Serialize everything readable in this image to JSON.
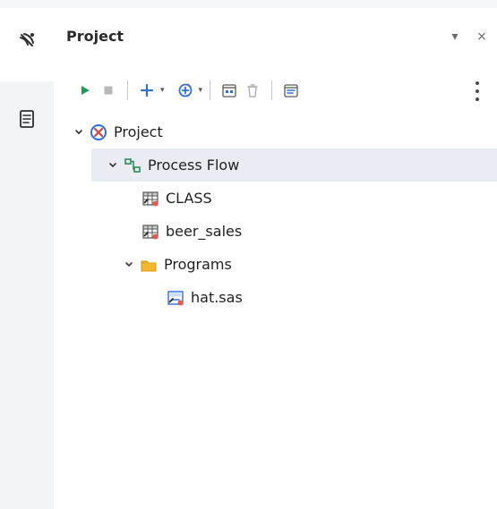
{
  "panel": {
    "title": "Project",
    "actions": {
      "menu_glyph": "▾",
      "close_glyph": "×"
    }
  },
  "left_rail": {
    "icons": [
      "satellite-icon",
      "document-icon"
    ]
  },
  "toolbar": {
    "buttons": [
      "run-icon",
      "stop-icon",
      "add-icon",
      "add-task-icon",
      "schedule-icon",
      "delete-icon",
      "properties-icon",
      "more-icon"
    ]
  },
  "tree": {
    "project_label": "Project",
    "process_flow_label": "Process Flow",
    "items": [
      {
        "label": "CLASS"
      },
      {
        "label": "beer_sales"
      }
    ],
    "programs_label": "Programs",
    "program_item_label": "hat.sas"
  },
  "colors": {
    "accent_blue": "#2f6fd6",
    "run_green": "#1f9d55",
    "folder_yellow": "#f2b82e",
    "selected_row": "#e9edf3"
  }
}
